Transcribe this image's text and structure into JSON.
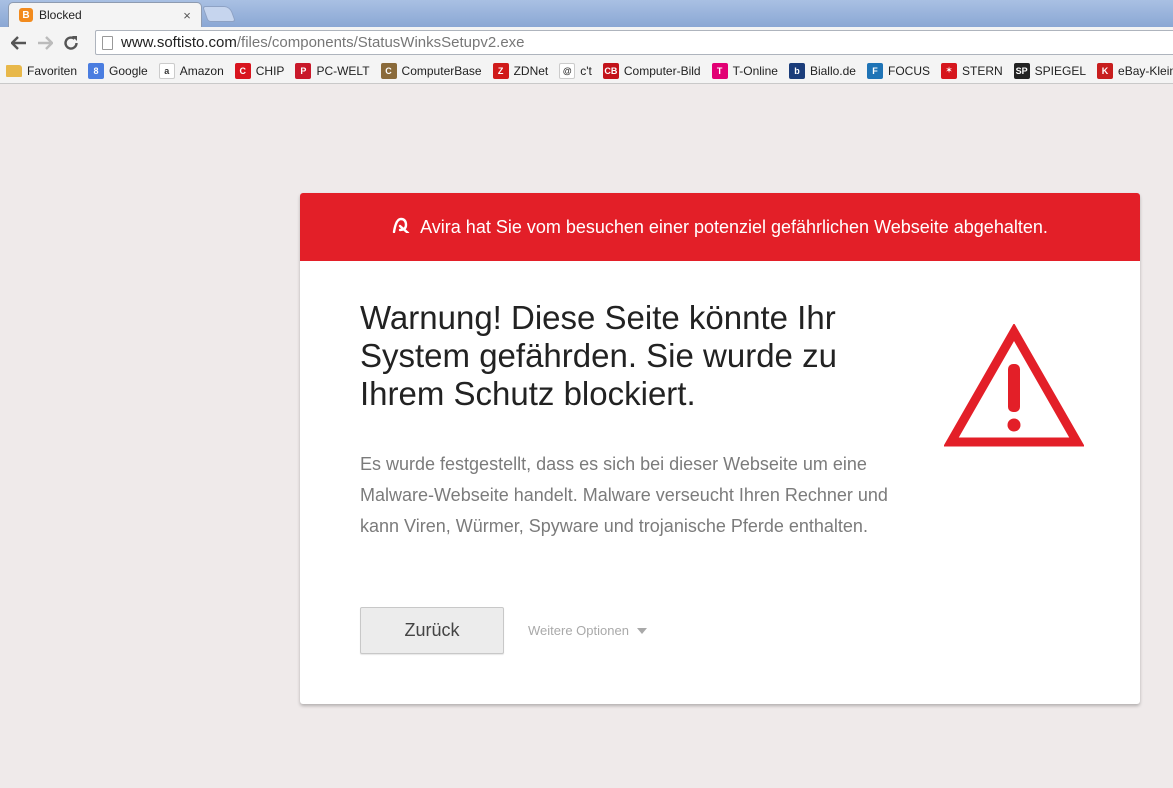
{
  "browser": {
    "tab_title": "Blocked",
    "tab_close": "×",
    "url_host": "www.softisto.com",
    "url_path": "/files/components/StatusWinksSetupv2.exe"
  },
  "bookmarks": [
    {
      "label": "Favoriten",
      "icon": "folder-icon",
      "color": "#e8b84a",
      "glyph": ""
    },
    {
      "label": "Google",
      "icon": "google-icon",
      "color": "#4a7de0",
      "glyph": "8"
    },
    {
      "label": "Amazon",
      "icon": "amazon-icon",
      "color": "#ffffff",
      "glyph": "a"
    },
    {
      "label": "CHIP",
      "icon": "chip-icon",
      "color": "#d8141e",
      "glyph": "C"
    },
    {
      "label": "PC-WELT",
      "icon": "pcwelt-icon",
      "color": "#c9182a",
      "glyph": "P"
    },
    {
      "label": "ComputerBase",
      "icon": "computerbase-icon",
      "color": "#8a6a3a",
      "glyph": "C"
    },
    {
      "label": "ZDNet",
      "icon": "zdnet-icon",
      "color": "#d01b1b",
      "glyph": "Z"
    },
    {
      "label": "c't",
      "icon": "ct-icon",
      "color": "#ffffff",
      "glyph": "@"
    },
    {
      "label": "Computer-Bild",
      "icon": "computerbild-icon",
      "color": "#c3131b",
      "glyph": "CB"
    },
    {
      "label": "T-Online",
      "icon": "tonline-icon",
      "color": "#e20074",
      "glyph": "T"
    },
    {
      "label": "Biallo.de",
      "icon": "biallo-icon",
      "color": "#1b3d7a",
      "glyph": "b"
    },
    {
      "label": "FOCUS",
      "icon": "focus-icon",
      "color": "#1f74b6",
      "glyph": "F"
    },
    {
      "label": "STERN",
      "icon": "stern-icon",
      "color": "#d6161d",
      "glyph": "✶"
    },
    {
      "label": "SPIEGEL",
      "icon": "spiegel-icon",
      "color": "#222222",
      "glyph": "SP"
    },
    {
      "label": "eBay-Kleina",
      "icon": "ebay-kleinanzeigen-icon",
      "color": "#c81e1e",
      "glyph": "K"
    }
  ],
  "card": {
    "header_text": "Avira hat Sie vom besuchen einer potenziel gefährlichen Webseite abgehalten.",
    "headline": "Warnung! Diese Seite könnte Ihr System gefährden. Sie wurde zu Ihrem Schutz blockiert.",
    "description": "Es wurde festgestellt, dass es sich bei dieser Webseite um eine Malware-Webseite handelt. Malware verseucht Ihren Rechner und kann Viren, Würmer, Spyware und trojanische Pferde enthalten.",
    "back_button": "Zurück",
    "more_options": "Weitere Optionen",
    "accent_color": "#e31f28"
  }
}
